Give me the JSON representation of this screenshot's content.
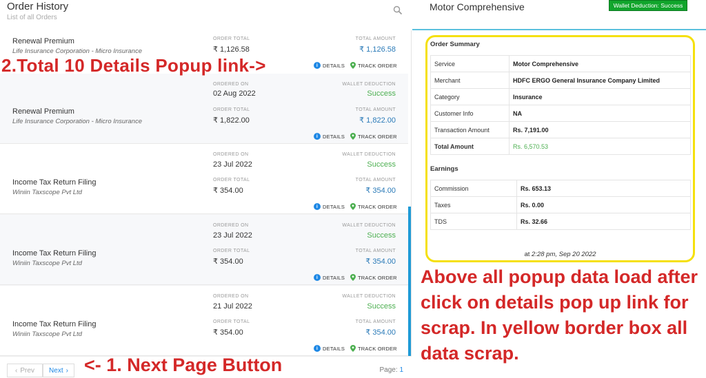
{
  "left": {
    "title": "Order History",
    "subtitle": "List of all Orders",
    "labels": {
      "order_total": "ORDER TOTAL",
      "total_amount": "TOTAL AMOUNT",
      "ordered_on": "ORDERED ON",
      "wallet_deduction": "WALLET DEDUCTION",
      "details": "DETAILS",
      "track_order": "TRACK ORDER"
    },
    "orders": [
      {
        "service": "Renewal Premium",
        "merchant": "Life Insurance Corporation - Micro Insurance",
        "ordered_on": "",
        "status": "",
        "order_total": "₹ 1,126.58",
        "total_amount": "₹ 1,126.58"
      },
      {
        "service": "Renewal Premium",
        "merchant": "Life Insurance Corporation - Micro Insurance",
        "ordered_on": "02 Aug 2022",
        "status": "Success",
        "order_total": "₹ 1,822.00",
        "total_amount": "₹ 1,822.00"
      },
      {
        "service": "Income Tax Return Filing",
        "merchant": "Winiin Taxscope Pvt Ltd",
        "ordered_on": "23 Jul 2022",
        "status": "Success",
        "order_total": "₹ 354.00",
        "total_amount": "₹ 354.00"
      },
      {
        "service": "Income Tax Return Filing",
        "merchant": "Winiin Taxscope Pvt Ltd",
        "ordered_on": "23 Jul 2022",
        "status": "Success",
        "order_total": "₹ 354.00",
        "total_amount": "₹ 354.00"
      },
      {
        "service": "Income Tax Return Filing",
        "merchant": "Winiin Taxscope Pvt Ltd",
        "ordered_on": "21 Jul 2022",
        "status": "Success",
        "order_total": "₹ 354.00",
        "total_amount": "₹ 354.00"
      }
    ],
    "pager": {
      "prev": "Prev",
      "next": "Next",
      "page_label": "Page:",
      "page_num": "1"
    }
  },
  "annotations": {
    "details": "2.Total 10 Details Popup link->",
    "next": "<- 1. Next Page Button",
    "popup": "Above all popup data load after click on details pop up link for scrap. In yellow border box all data scrap."
  },
  "right": {
    "title": "Motor Comprehensive",
    "badge": "Wallet Deduction: Success",
    "summary_title": "Order Summary",
    "summary": [
      {
        "k": "Service",
        "v": "Motor Comprehensive"
      },
      {
        "k": "Merchant",
        "v": "HDFC ERGO General Insurance Company Limited"
      },
      {
        "k": "Category",
        "v": "Insurance"
      },
      {
        "k": "Customer Info",
        "v": "NA"
      },
      {
        "k": "Transaction Amount",
        "v": "Rs. 7,191.00"
      },
      {
        "k": "Total Amount",
        "v": "Rs. 6,570.53"
      }
    ],
    "earnings_title": "Earnings",
    "earnings": [
      {
        "k": "Commission",
        "v": "Rs. 653.13"
      },
      {
        "k": "Taxes",
        "v": "Rs. 0.00"
      },
      {
        "k": "TDS",
        "v": "Rs. 32.66"
      }
    ],
    "ts_prefix": "at",
    "ts_value": "2:28 pm, Sep 20 2022"
  },
  "colors": {
    "accent": "#1e88e5",
    "success": "#4caf50",
    "annotation": "#d42828",
    "highlight_border": "#f5e00c",
    "badge": "#11a52c"
  }
}
